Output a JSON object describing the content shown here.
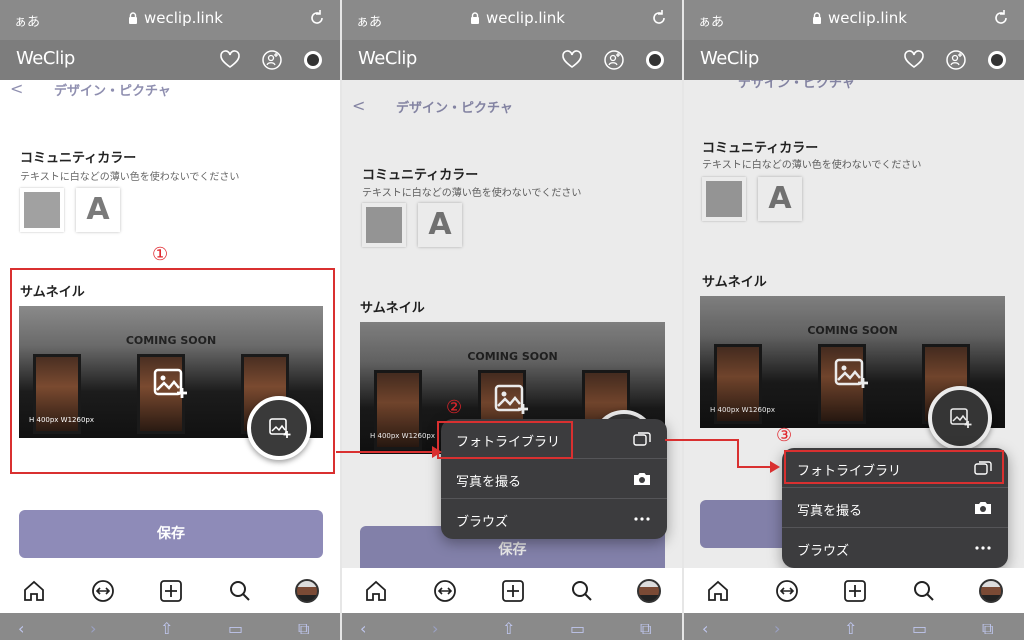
{
  "browser": {
    "aa_label": "ぁあ",
    "url": "weclip.link"
  },
  "app": {
    "logo": "WeClip",
    "header_icons": [
      "heart-icon",
      "add-person-icon",
      "globe-icon"
    ]
  },
  "page": {
    "back_label": "<",
    "title": "デザイン・ピクチャ"
  },
  "community_color": {
    "title": "コミュニティカラー",
    "subtitle": "テキストに白などの薄い色を使わないでください",
    "swatch_color": "#a1a1a1",
    "letter": "A"
  },
  "thumbnail": {
    "title": "サムネイル",
    "banner_text": "COMING SOON",
    "size_note": "H 400px W1260px"
  },
  "save_label": "保存",
  "menu": {
    "items": [
      {
        "label": "フォトライブラリ",
        "icon": "photo-library-icon"
      },
      {
        "label": "写真を撮る",
        "icon": "camera-icon"
      },
      {
        "label": "ブラウズ",
        "icon": "more-icon"
      }
    ]
  },
  "steps": [
    "①",
    "②",
    "③"
  ],
  "colors": {
    "accent": "#8e8bb8",
    "annotation": "#d93030",
    "header_bg": "#7d7d7d"
  }
}
